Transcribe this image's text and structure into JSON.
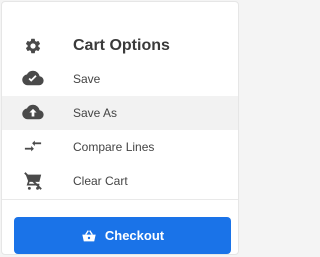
{
  "header": {
    "title": "Cart Options",
    "icon": "gear-icon"
  },
  "menu": {
    "items": [
      {
        "label": "Save",
        "icon": "cloud-check-icon"
      },
      {
        "label": "Save As",
        "icon": "cloud-upload-icon"
      },
      {
        "label": "Compare Lines",
        "icon": "compare-arrows-icon"
      },
      {
        "label": "Clear Cart",
        "icon": "remove-cart-icon"
      }
    ],
    "active_item": "Save As"
  },
  "checkout": {
    "label": "Checkout",
    "icon": "shopping-basket-icon"
  },
  "colors": {
    "accent": "#1a73e8",
    "icon": "#4a4a4a"
  }
}
